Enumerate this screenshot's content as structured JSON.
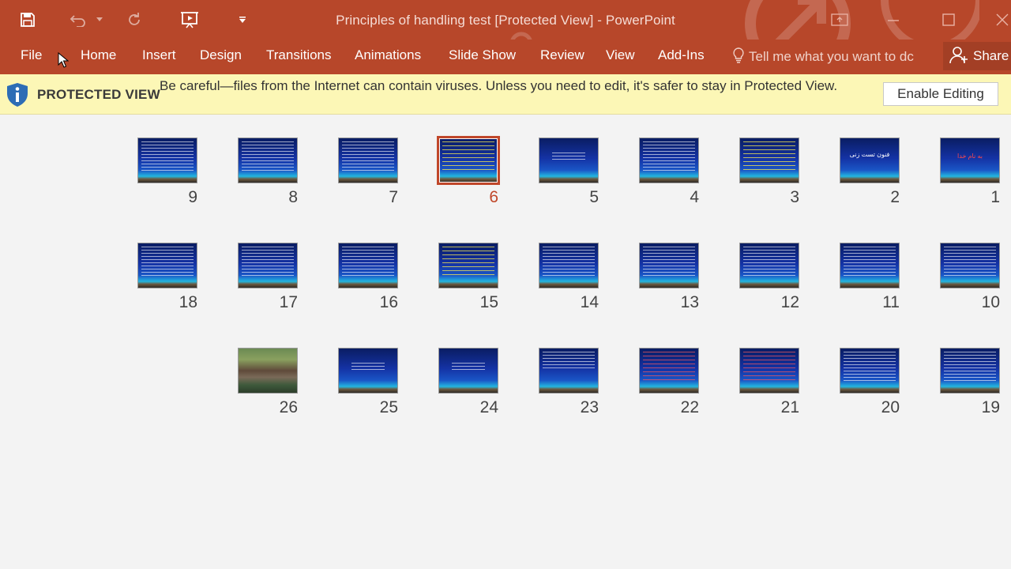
{
  "window": {
    "title": "Principles of handling test [Protected View] - PowerPoint",
    "accent": "#b7472a"
  },
  "quick_access": {
    "save": "save-icon",
    "undo": "undo-icon",
    "redo": "redo-icon",
    "slideshow": "start-slideshow-icon",
    "customize": "customize-icon"
  },
  "ribbon": {
    "tabs": [
      "File",
      "Home",
      "Insert",
      "Design",
      "Transitions",
      "Animations",
      "Slide Show",
      "Review",
      "View",
      "Add-Ins"
    ],
    "tell_me_placeholder": "Tell me what you want to dc",
    "share_label": "Share"
  },
  "protected_view": {
    "label": "PROTECTED VIEW",
    "message": "Be careful—files from the Internet can contain viruses. Unless you need to edit, it's safer to stay in Protected View.",
    "button": "Enable Editing",
    "background": "#fcf7b6"
  },
  "slides": [
    {
      "number": "1",
      "style": "title-red",
      "title": "به نام خدا"
    },
    {
      "number": "2",
      "style": "title-white",
      "title": "فنون تست زنی"
    },
    {
      "number": "3",
      "style": "yellow",
      "title": ""
    },
    {
      "number": "4",
      "style": "white",
      "title": ""
    },
    {
      "number": "5",
      "style": "sparse",
      "title": ""
    },
    {
      "number": "6",
      "style": "yellow",
      "title": "",
      "selected": true
    },
    {
      "number": "7",
      "style": "white",
      "title": ""
    },
    {
      "number": "8",
      "style": "white",
      "title": ""
    },
    {
      "number": "9",
      "style": "white",
      "title": ""
    },
    {
      "number": "10",
      "style": "white",
      "title": ""
    },
    {
      "number": "11",
      "style": "white",
      "title": ""
    },
    {
      "number": "12",
      "style": "white",
      "title": ""
    },
    {
      "number": "13",
      "style": "white",
      "title": ""
    },
    {
      "number": "14",
      "style": "white",
      "title": ""
    },
    {
      "number": "15",
      "style": "yellow",
      "title": ""
    },
    {
      "number": "16",
      "style": "white",
      "title": ""
    },
    {
      "number": "17",
      "style": "white",
      "title": ""
    },
    {
      "number": "18",
      "style": "white",
      "title": ""
    },
    {
      "number": "19",
      "style": "white",
      "title": ""
    },
    {
      "number": "20",
      "style": "white",
      "title": ""
    },
    {
      "number": "21",
      "style": "red",
      "title": ""
    },
    {
      "number": "22",
      "style": "red",
      "title": ""
    },
    {
      "number": "23",
      "style": "fewlines",
      "title": ""
    },
    {
      "number": "24",
      "style": "sparse",
      "title": ""
    },
    {
      "number": "25",
      "style": "sparse",
      "title": ""
    },
    {
      "number": "26",
      "style": "photo",
      "title": ""
    }
  ]
}
